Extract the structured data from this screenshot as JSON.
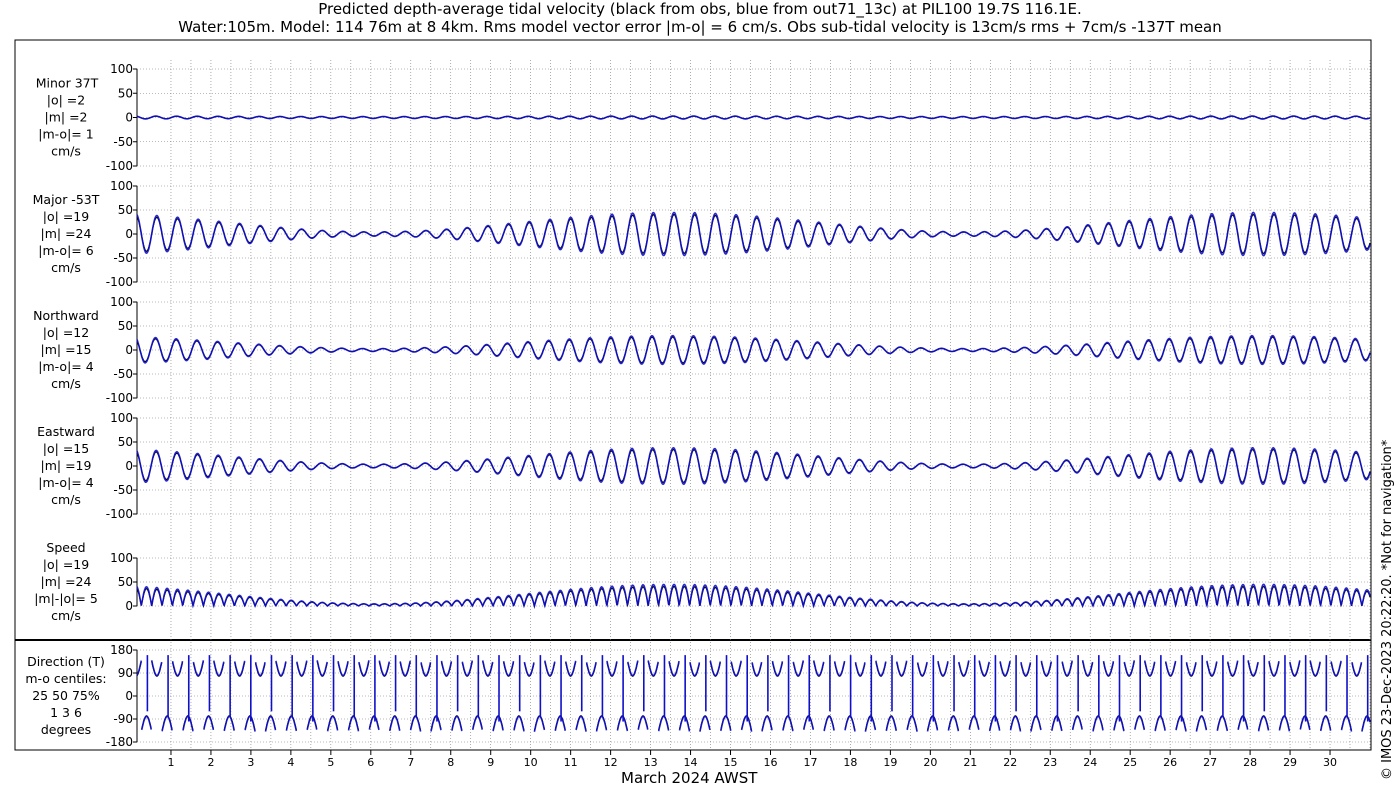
{
  "title": {
    "line1": "Predicted depth-average tidal velocity (black from obs, blue from out71_13c) at PIL100 19.7S 116.1E.",
    "line2": "Water:105m. Model: 114 76m at 8 4km. Rms model vector error |m-o| = 6 cm/s. Obs sub-tidal velocity is 13cm/s rms + 7cm/s -137T mean"
  },
  "xlabel": "March 2024 AWST",
  "copyright": "© IMOS 23-Dec-2023 20:22:20. *Not for navigation*",
  "colors": {
    "obs": "#000000",
    "model": "#1010c8",
    "grid": "#777777"
  },
  "chart_data": [
    {
      "type": "line",
      "name_label": [
        "Minor 37T",
        "|o| =2",
        "|m| =2",
        "|m-o|= 1",
        "cm/s"
      ],
      "ylim": [
        -100,
        100
      ],
      "yticks": [
        100,
        50,
        0,
        -50,
        -100
      ],
      "kind": "minor",
      "amp": 3
    },
    {
      "type": "line",
      "name_label": [
        "Major -53T",
        "|o| =19",
        "|m| =24",
        "|m-o|= 6",
        "cm/s"
      ],
      "ylim": [
        -100,
        100
      ],
      "yticks": [
        100,
        50,
        0,
        -50,
        -100
      ],
      "kind": "major",
      "amp": 45
    },
    {
      "type": "line",
      "name_label": [
        "Northward",
        "|o| =12",
        "|m| =15",
        "|m-o|= 4",
        "cm/s"
      ],
      "ylim": [
        -100,
        100
      ],
      "yticks": [
        100,
        50,
        0,
        -50,
        -100
      ],
      "kind": "north",
      "amp": 30
    },
    {
      "type": "line",
      "name_label": [
        "Eastward",
        "|o| =15",
        "|m| =19",
        "|m-o|= 4",
        "cm/s"
      ],
      "ylim": [
        -100,
        100
      ],
      "yticks": [
        100,
        50,
        0,
        -50,
        -100
      ],
      "kind": "east",
      "amp": 38
    },
    {
      "type": "line",
      "name_label": [
        "Speed",
        "|o| =19",
        "|m| =24",
        "|m|-|o|= 5",
        "cm/s"
      ],
      "ylim": [
        0,
        100
      ],
      "yticks": [
        100,
        50,
        0
      ],
      "kind": "speed",
      "amp": 45
    },
    {
      "type": "line",
      "name_label": [
        "Direction (T)",
        "m-o centiles:",
        "25  50  75%",
        "1  3  6",
        "degrees"
      ],
      "ylim": [
        -180,
        180
      ],
      "yticks": [
        180,
        90,
        0,
        -90,
        -180
      ],
      "kind": "dir",
      "amp": 180
    }
  ],
  "x": {
    "days": [
      "1",
      "2",
      "3",
      "4",
      "5",
      "6",
      "7",
      "8",
      "9",
      "10",
      "11",
      "12",
      "13",
      "14",
      "15",
      "16",
      "17",
      "18",
      "19",
      "20",
      "21",
      "22",
      "23",
      "24",
      "25",
      "26",
      "27",
      "28",
      "29",
      "30"
    ],
    "range_days": [
      0.15,
      31.0
    ]
  }
}
